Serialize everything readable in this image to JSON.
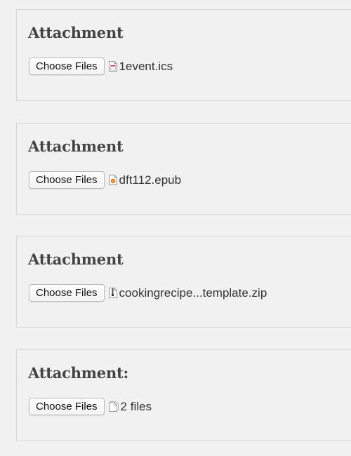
{
  "panels": [
    {
      "title": "Attachment",
      "button_label": "Choose Files",
      "file_label": "1event.ics",
      "icon": "calendar-file-icon"
    },
    {
      "title": "Attachment",
      "button_label": "Choose Files",
      "file_label": "dft112.epub",
      "icon": "epub-file-icon"
    },
    {
      "title": "Attachment",
      "button_label": "Choose Files",
      "file_label": "cookingrecipe...template.zip",
      "icon": "zip-file-icon"
    },
    {
      "title": "Attachment:",
      "button_label": "Choose Files",
      "file_label": "2 files",
      "icon": "multiple-files-icon"
    }
  ]
}
